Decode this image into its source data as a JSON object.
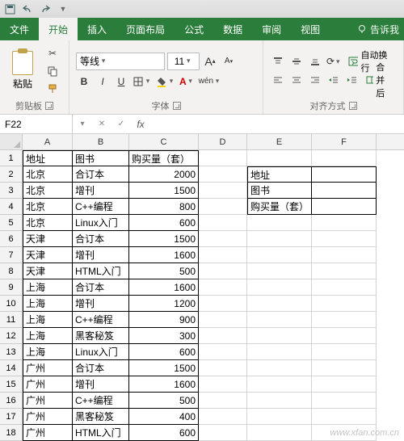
{
  "titlebar": {
    "save": "保存",
    "undo": "撤销",
    "redo": "重做"
  },
  "menu": {
    "file": "文件",
    "home": "开始",
    "insert": "插入",
    "page": "页面布局",
    "formulas": "公式",
    "data": "数据",
    "review": "审阅",
    "view": "视图",
    "tellme": "告诉我"
  },
  "ribbon": {
    "clipboard": {
      "paste": "粘贴",
      "label": "剪贴板"
    },
    "font": {
      "name": "等线",
      "size": "11",
      "grow": "A",
      "shrink": "A",
      "phonetic": "wén",
      "bold": "B",
      "italic": "I",
      "underline": "U",
      "label": "字体"
    },
    "align": {
      "wrap": "自动换行",
      "merge": "合并后",
      "label": "对齐方式"
    }
  },
  "namebox": "F22",
  "formula": "",
  "columns": [
    "A",
    "B",
    "C",
    "D",
    "E",
    "F"
  ],
  "headers": {
    "a": "地址",
    "b": "图书",
    "c": "购买量（套）"
  },
  "rows": [
    {
      "a": "北京",
      "b": "合订本",
      "c": "2000"
    },
    {
      "a": "北京",
      "b": "增刊",
      "c": "1500"
    },
    {
      "a": "北京",
      "b": "C++编程",
      "c": "800"
    },
    {
      "a": "北京",
      "b": "Linux入门",
      "c": "600"
    },
    {
      "a": "天津",
      "b": "合订本",
      "c": "1500"
    },
    {
      "a": "天津",
      "b": "增刊",
      "c": "1600"
    },
    {
      "a": "天津",
      "b": "HTML入门",
      "c": "500"
    },
    {
      "a": "上海",
      "b": "合订本",
      "c": "1600"
    },
    {
      "a": "上海",
      "b": "增刊",
      "c": "1200"
    },
    {
      "a": "上海",
      "b": "C++编程",
      "c": "900"
    },
    {
      "a": "上海",
      "b": "黑客秘笈",
      "c": "300"
    },
    {
      "a": "上海",
      "b": "Linux入门",
      "c": "600"
    },
    {
      "a": "广州",
      "b": "合订本",
      "c": "1500"
    },
    {
      "a": "广州",
      "b": "增刊",
      "c": "1600"
    },
    {
      "a": "广州",
      "b": "C++编程",
      "c": "500"
    },
    {
      "a": "广州",
      "b": "黑客秘笈",
      "c": "400"
    },
    {
      "a": "广州",
      "b": "HTML入门",
      "c": "600"
    }
  ],
  "side": {
    "e2": "地址",
    "e3": "图书",
    "e4": "购买量（套）"
  },
  "watermark": "www.xfan.com.cn"
}
